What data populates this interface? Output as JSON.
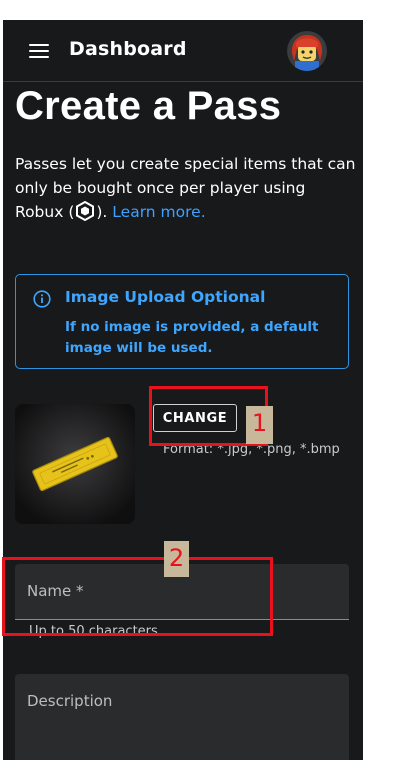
{
  "header": {
    "title": "Dashboard",
    "menu_icon": "hamburger-menu-icon",
    "avatar_icon": "user-avatar"
  },
  "page": {
    "title": "Create a Pass",
    "intro_text": "Passes let you create special items that can only be bought once per player using Robux (",
    "intro_after_icon": ").",
    "learn_more": "Learn more."
  },
  "alert": {
    "title": "Image Upload Optional",
    "body": "If no image is provided, a default image will be used.",
    "icon": "info-icon"
  },
  "upload": {
    "change_label": "CHANGE",
    "format_text": "Format: *.jpg, *.png, *.bmp"
  },
  "form": {
    "name_label": "Name *",
    "name_helper": "Up to 50 characters",
    "description_label": "Description"
  },
  "annotations": {
    "one": "1",
    "two": "2"
  },
  "colors": {
    "background": "#18191b",
    "accent": "#3fa6ff",
    "field_bg": "#2a2b2d",
    "annotation": "#e8111c",
    "annotation_label_bg": "#c8b89b"
  }
}
